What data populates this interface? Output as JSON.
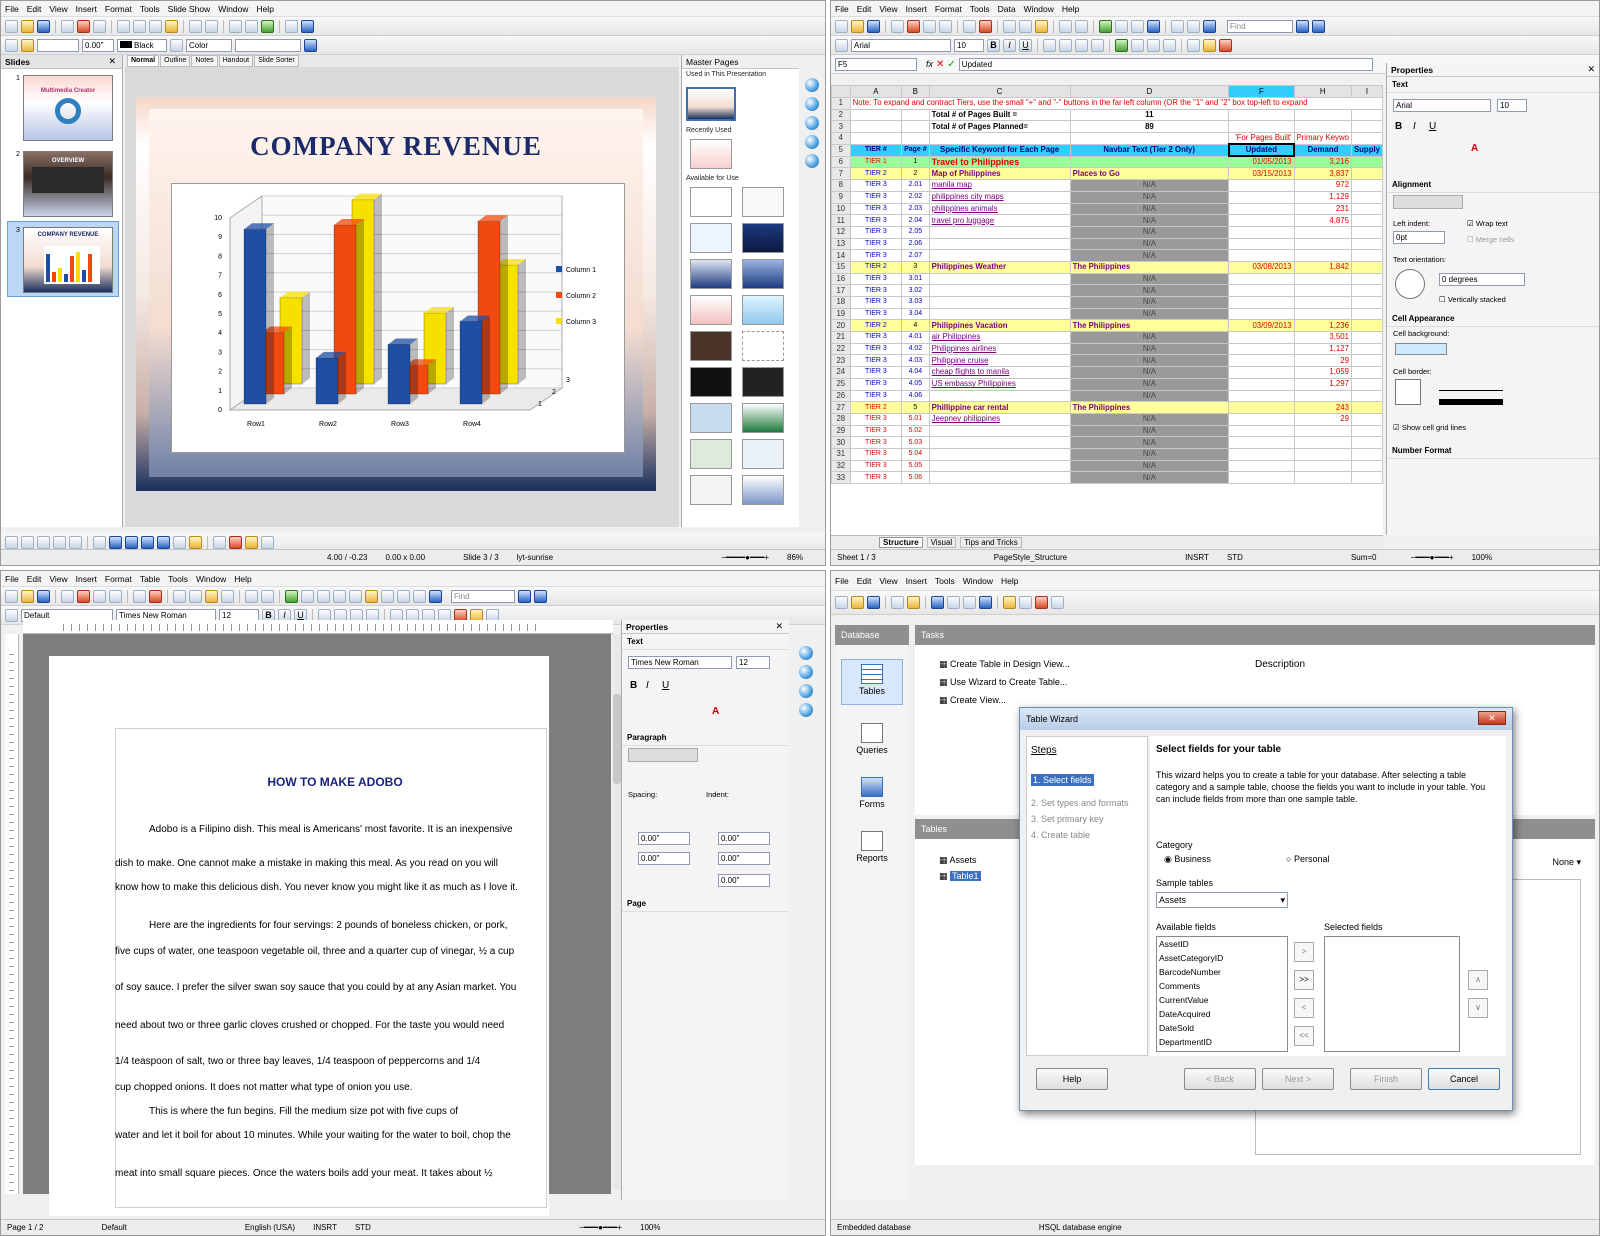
{
  "impress": {
    "menu": [
      "File",
      "Edit",
      "View",
      "Insert",
      "Format",
      "Tools",
      "Slide Show",
      "Window",
      "Help"
    ],
    "toolbar_line_value": "0.00\"",
    "toolbar_color_label": "Black",
    "toolbar_fill_label": "Color",
    "slides_pane_title": "Slides",
    "thumbs": [
      {
        "num": "1",
        "label": "Multimedia Creator"
      },
      {
        "num": "2",
        "label": "OVERVIEW"
      },
      {
        "num": "3",
        "label": "COMPANY REVENUE"
      }
    ],
    "view_tabs": [
      "Normal",
      "Outline",
      "Notes",
      "Handout",
      "Slide Sorter"
    ],
    "slide_title": "COMPANY REVENUE",
    "master_pages_title": "Master Pages",
    "master_sections": [
      "Used in This Presentation",
      "Recently Used",
      "Available for Use"
    ],
    "status": {
      "position": "4.00 / -0.23",
      "size": "0.00 x 0.00",
      "slide": "Slide 3 / 3",
      "layout": "lyt-sunrise",
      "zoom": "86%"
    }
  },
  "chart_data": {
    "type": "bar",
    "categories": [
      "Row1",
      "Row2",
      "Row3",
      "Row4"
    ],
    "series": [
      {
        "name": "Column 1",
        "values": [
          9.1,
          2.4,
          3.1,
          4.3
        ],
        "color": "#1f4fa3"
      },
      {
        "name": "Column 2",
        "values": [
          3.2,
          8.8,
          1.5,
          9.0
        ],
        "color": "#f04a10"
      },
      {
        "name": "Column 3",
        "values": [
          4.5,
          9.6,
          3.7,
          6.2
        ],
        "color": "#f5e000"
      }
    ],
    "yticks": [
      "0",
      "1",
      "2",
      "3",
      "4",
      "5",
      "6",
      "7",
      "8",
      "9",
      "10"
    ],
    "ylim": [
      0,
      10
    ],
    "depth_labels": [
      "1",
      "2",
      "3"
    ],
    "legend_position": "right"
  },
  "calc": {
    "menu": [
      "File",
      "Edit",
      "View",
      "Insert",
      "Format",
      "Tools",
      "Data",
      "Window",
      "Help"
    ],
    "find_placeholder": "Find",
    "font_name": "Arial",
    "font_size": "10",
    "name_box": "F5",
    "formula": "Updated",
    "columns": [
      "A",
      "B",
      "C",
      "D",
      "F",
      "H",
      "I"
    ],
    "rows": [
      {
        "n": "1",
        "a": "Note:  To expand and contract Tiers, use the small \"+\" and \"-\" buttons in the far left column (OR the \"1\" and \"2\" box top-left to expand",
        "style": "note"
      },
      {
        "n": "2",
        "c": "Total # of Pages Built =",
        "d": "11"
      },
      {
        "n": "3",
        "c": "Total # of Pages Planned=",
        "d": "89"
      },
      {
        "n": "4",
        "f": "'For Pages Built'",
        "h": "Primary Keywo"
      },
      {
        "n": "5",
        "a": "TIER #",
        "b": "Page #",
        "c": "Specific Keyword for Each Page",
        "d": "Navbar Text   (Tier 2 Only)",
        "f": "Updated",
        "h": "Demand",
        "i": "Supply",
        "style": "header"
      },
      {
        "n": "6",
        "a": "TIER 1",
        "b": "1",
        "c": "Travel to Philippines",
        "f": "01/05/2013",
        "h": "3,216",
        "style": "tier1"
      },
      {
        "n": "7",
        "a": "TIER 2",
        "b": "2",
        "c": "Map of Philippines",
        "d": "Places to Go",
        "f": "03/15/2013",
        "h": "3,837",
        "style": "tier2"
      },
      {
        "n": "8",
        "a": "TIER 3",
        "b": "2.01",
        "c": "manila map",
        "d": "N/A",
        "h": "972",
        "style": "t3"
      },
      {
        "n": "9",
        "a": "TIER 3",
        "b": "2.02",
        "c": "philippines city maps",
        "d": "N/A",
        "h": "1,129",
        "style": "t3"
      },
      {
        "n": "10",
        "a": "TIER 3",
        "b": "2.03",
        "c": "philippines animals",
        "d": "N/A",
        "h": "231",
        "style": "t3"
      },
      {
        "n": "11",
        "a": "TIER 3",
        "b": "2.04",
        "c": "travel pro luggage",
        "d": "N/A",
        "h": "4,875",
        "style": "t3"
      },
      {
        "n": "12",
        "a": "TIER 3",
        "b": "2.05",
        "d": "N/A",
        "style": "t3"
      },
      {
        "n": "13",
        "a": "TIER 3",
        "b": "2.06",
        "d": "N/A",
        "style": "t3"
      },
      {
        "n": "14",
        "a": "TIER 3",
        "b": "2.07",
        "d": "N/A",
        "style": "t3"
      },
      {
        "n": "15",
        "a": "TIER 2",
        "b": "3",
        "c": "Philippines Weather",
        "d": "The Philippines",
        "f": "03/08/2013",
        "h": "1,842",
        "style": "tier2"
      },
      {
        "n": "16",
        "a": "TIER 3",
        "b": "3.01",
        "d": "N/A",
        "style": "t3"
      },
      {
        "n": "17",
        "a": "TIER 3",
        "b": "3.02",
        "d": "N/A",
        "style": "t3"
      },
      {
        "n": "18",
        "a": "TIER 3",
        "b": "3.03",
        "d": "N/A",
        "style": "t3"
      },
      {
        "n": "19",
        "a": "TIER 3",
        "b": "3.04",
        "d": "N/A",
        "style": "t3"
      },
      {
        "n": "20",
        "a": "TIER 2",
        "b": "4",
        "c": "Philippines Vacation",
        "d": "The Philippines",
        "f": "03/09/2013",
        "h": "1,236",
        "style": "tier2"
      },
      {
        "n": "21",
        "a": "TIER 3",
        "b": "4.01",
        "c": "air Philippines",
        "d": "N/A",
        "h": "3,501",
        "style": "t3"
      },
      {
        "n": "22",
        "a": "TIER 3",
        "b": "4.02",
        "c": "Philippines airlines",
        "d": "N/A",
        "h": "1,127",
        "style": "t3"
      },
      {
        "n": "23",
        "a": "TIER 3",
        "b": "4.03",
        "c": "Philippine cruise",
        "d": "N/A",
        "h": "29",
        "style": "t3"
      },
      {
        "n": "24",
        "a": "TIER 3",
        "b": "4.04",
        "c": "cheap flights to manila",
        "d": "N/A",
        "h": "1,059",
        "style": "t3"
      },
      {
        "n": "25",
        "a": "TIER 3",
        "b": "4.05",
        "c": "US embassy Philippines",
        "d": "N/A",
        "h": "1,297",
        "style": "t3"
      },
      {
        "n": "26",
        "a": "TIER 3",
        "b": "4.06",
        "d": "N/A",
        "style": "t3"
      },
      {
        "n": "27",
        "a": "TIER 2",
        "b": "5",
        "c": "Phillippine car rental",
        "d": "The Philippines",
        "h": "243",
        "style": "tier2r"
      },
      {
        "n": "28",
        "a": "TIER 3",
        "b": "5.01",
        "c": "Jeepney philippines",
        "d": "N/A",
        "h": "29",
        "style": "t3r"
      },
      {
        "n": "29",
        "a": "TIER 3",
        "b": "5.02",
        "d": "N/A",
        "style": "t3r"
      },
      {
        "n": "30",
        "a": "TIER 3",
        "b": "5.03",
        "d": "N/A",
        "style": "t3r"
      },
      {
        "n": "31",
        "a": "TIER 3",
        "b": "5.04",
        "d": "N/A",
        "style": "t3r"
      },
      {
        "n": "32",
        "a": "TIER 3",
        "b": "5.05",
        "d": "N/A",
        "style": "t3r"
      },
      {
        "n": "33",
        "a": "TIER 3",
        "b": "5.06",
        "d": "N/A",
        "style": "t3r"
      }
    ],
    "sheet_tabs": [
      "Structure",
      "Visual",
      "Tips and Tricks"
    ],
    "status": {
      "sheet": "Sheet 1 / 3",
      "style": "PageStyle_Structure",
      "mode": "INSRT",
      "sel": "STD",
      "sum": "Sum=0",
      "zoom": "100%"
    },
    "properties": {
      "title": "Properties",
      "text": "Text",
      "font": "Arial",
      "size": "10",
      "alignment": "Alignment",
      "wrap": "Wrap text",
      "left_indent": "Left indent:",
      "indent_value": "0pt",
      "merge": "Merge cells",
      "orientation": "Text orientation:",
      "degrees": "0 degrees",
      "stacked": "Vertically stacked",
      "appearance": "Cell Appearance",
      "background": "Cell background:",
      "border": "Cell border:",
      "gridlines": "Show cell grid lines",
      "number": "Number Format"
    }
  },
  "writer": {
    "menu": [
      "File",
      "Edit",
      "View",
      "Insert",
      "Format",
      "Table",
      "Tools",
      "Window",
      "Help"
    ],
    "find_placeholder": "Find",
    "para_style": "Default",
    "font": "Times New Roman",
    "size": "12",
    "title": "HOW TO MAKE ADOBO",
    "lines": [
      "Adobo is a Filipino dish.  This meal is Americans' most favorite.  It is an inexpensive",
      "dish to make.  One cannot make a mistake in making this meal.  As you read on you will",
      "know how to make this delicious dish.  You never know you might like it as much as I love  it.",
      "Here are the ingredients for four servings: 2 pounds of boneless chicken, or pork,",
      "five cups of water, one teaspoon vegetable oil, three and a quarter cup of vinegar,  ½  a cup",
      "of soy sauce. I prefer the silver swan soy sauce that you could by at any Asian market. You",
      "need about two or three garlic cloves crushed or chopped.  For the taste you would need",
      "1/4 teaspoon of salt, two or three bay leaves, 1/4 teaspoon of peppercorns and 1/4",
      "cup chopped onions. It does not matter what type of onion you use.",
      "This is where the fun begins. Fill the medium size pot with five cups of",
      "water and let it boil for about 10 minutes.  While your waiting for the water to boil, chop the",
      "meat into small square pieces.  Once the waters boils add your meat.  It takes about ½"
    ],
    "properties": {
      "title": "Properties",
      "text": "Text",
      "font": "Times New Roman",
      "size": "12",
      "paragraph": "Paragraph",
      "spacing": "Spacing:",
      "indent": "Indent:",
      "values": [
        "0.00\"",
        "0.00\"",
        "0.00\"",
        "0.00\"",
        "0.00\""
      ],
      "page": "Page"
    },
    "status": {
      "page": "Page 1 / 2",
      "style": "Default",
      "lang": "English (USA)",
      "mode": "INSRT",
      "sel": "STD",
      "zoom": "100%"
    }
  },
  "base": {
    "menu": [
      "File",
      "Edit",
      "View",
      "Insert",
      "Tools",
      "Window",
      "Help"
    ],
    "db_title": "Database",
    "db_items": [
      "Tables",
      "Queries",
      "Forms",
      "Reports"
    ],
    "tasks_title": "Tasks",
    "tasks": [
      "Create Table in Design View...",
      "Use Wizard to Create Table...",
      "Create View..."
    ],
    "description": "Description",
    "tables_title": "Tables",
    "tables": [
      "Assets",
      "Table1"
    ],
    "none_label": "None",
    "wizard": {
      "title": "Table Wizard",
      "steps_title": "Steps",
      "steps": [
        "1. Select fields",
        "2. Set types and formats",
        "3. Set primary key",
        "4. Create table"
      ],
      "heading": "Select fields for your table",
      "intro": "This wizard helps you to create a table for your database. After selecting a table category and a sample table, choose the fields you want to include in your table. You can include fields from more than one sample table.",
      "category": "Category",
      "business": "Business",
      "personal": "Personal",
      "sample_tables": "Sample tables",
      "sample_value": "Assets",
      "available_fields": "Available fields",
      "selected_fields": "Selected fields",
      "fields": [
        "AssetID",
        "AssetCategoryID",
        "BarcodeNumber",
        "Comments",
        "CurrentValue",
        "DateAcquired",
        "DateSold",
        "DepartmentID"
      ],
      "buttons": {
        "help": "Help",
        "back": "< Back",
        "next": "Next >",
        "finish": "Finish",
        "cancel": "Cancel"
      }
    },
    "status": {
      "left": "Embedded database",
      "right": "HSQL database engine"
    }
  }
}
